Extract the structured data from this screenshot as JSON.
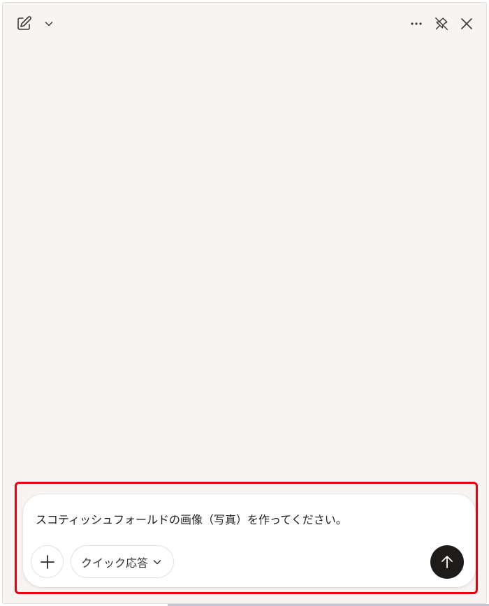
{
  "header": {
    "icons": [
      "new-chat-icon",
      "chevron-down-icon",
      "more-icon",
      "unpin-icon",
      "close-icon"
    ]
  },
  "composer": {
    "input_text": "スコティッシュフォールドの画像（写真）を作ってください。",
    "quick_reply_label": "クイック応答",
    "icons": [
      "plus-icon",
      "chevron-down-icon",
      "arrow-up-icon"
    ]
  },
  "colors": {
    "panel_background": "#f7f4f2",
    "highlight_border": "#e8000e",
    "send_button": "#1f1b19"
  }
}
